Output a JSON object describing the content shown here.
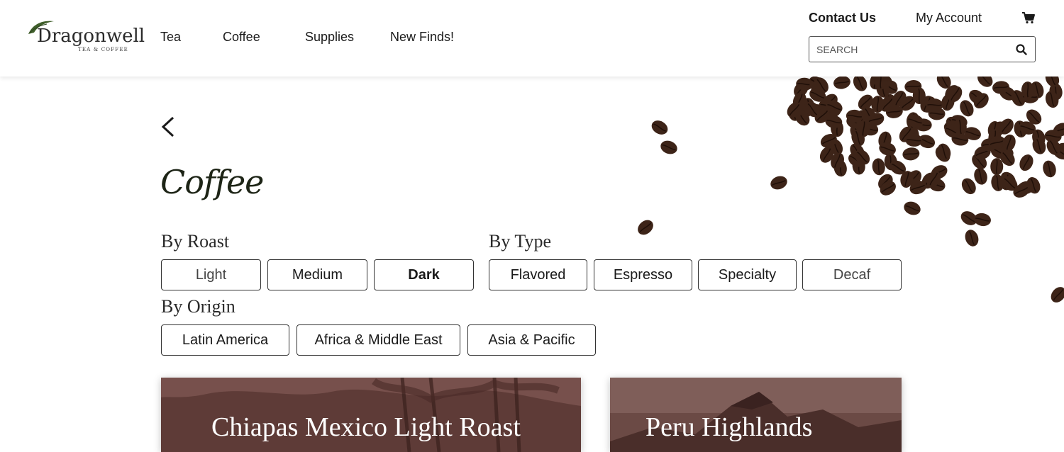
{
  "brand": {
    "name": "Dragonwell",
    "tagline": "TEA & COFFEE"
  },
  "nav": [
    {
      "label": "Tea"
    },
    {
      "label": "Coffee"
    },
    {
      "label": "Supplies"
    },
    {
      "label": "New Finds!"
    }
  ],
  "top_links": {
    "contact": "Contact Us",
    "account": "My Account"
  },
  "icons": {
    "cart": "cart-icon",
    "search": "search-icon",
    "back": "chevron-left-icon"
  },
  "search": {
    "placeholder": "SEARCH",
    "value": ""
  },
  "page": {
    "title": "Coffee"
  },
  "filters": {
    "roast": {
      "label": "By Roast",
      "options": [
        "Light",
        "Medium",
        "Dark"
      ]
    },
    "type": {
      "label": "By Type",
      "options": [
        "Flavored",
        "Espresso",
        "Specialty",
        "Decaf"
      ]
    },
    "origin": {
      "label": "By Origin",
      "options": [
        "Latin America",
        "Africa & Middle East",
        "Asia & Pacific"
      ]
    }
  },
  "products": [
    {
      "title": "Chiapas Mexico Light Roast"
    },
    {
      "title": "Peru Highlands"
    }
  ],
  "colors": {
    "card_overlay": "#5a3a35",
    "title_text": "#1d2416",
    "bean": "#3d2418"
  }
}
